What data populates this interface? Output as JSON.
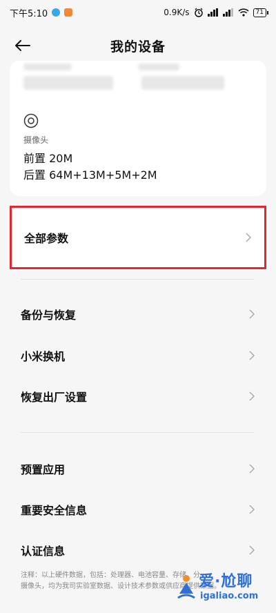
{
  "status_bar": {
    "time": "下午5:10",
    "network_speed": "0.9K/s",
    "battery": "71"
  },
  "header": {
    "title": "我的设备"
  },
  "camera": {
    "label": "摄像头",
    "front": "前置 20M",
    "rear": "后置 64M+13M+5M+2M"
  },
  "all_params": {
    "label": "全部参数"
  },
  "menu": {
    "backup": "备份与恢复",
    "xiaomi_switch": "小米换机",
    "factory_reset": "恢复出厂设置",
    "preinstalled_apps": "预置应用",
    "safety_info": "重要安全信息",
    "certification": "认证信息"
  },
  "footnote": {
    "line1": "注释：以上硬件数据，包括：处理器、电池容量、存储、分",
    "line2": "摄像头，均为我司实验室数据、设计技术参数或供应商提供数据。"
  },
  "watermark": {
    "name": "爱·尬聊",
    "url": "igaliao.com"
  },
  "colors": {
    "highlight_border": "#e0262e",
    "watermark": "#2f6fd6"
  }
}
